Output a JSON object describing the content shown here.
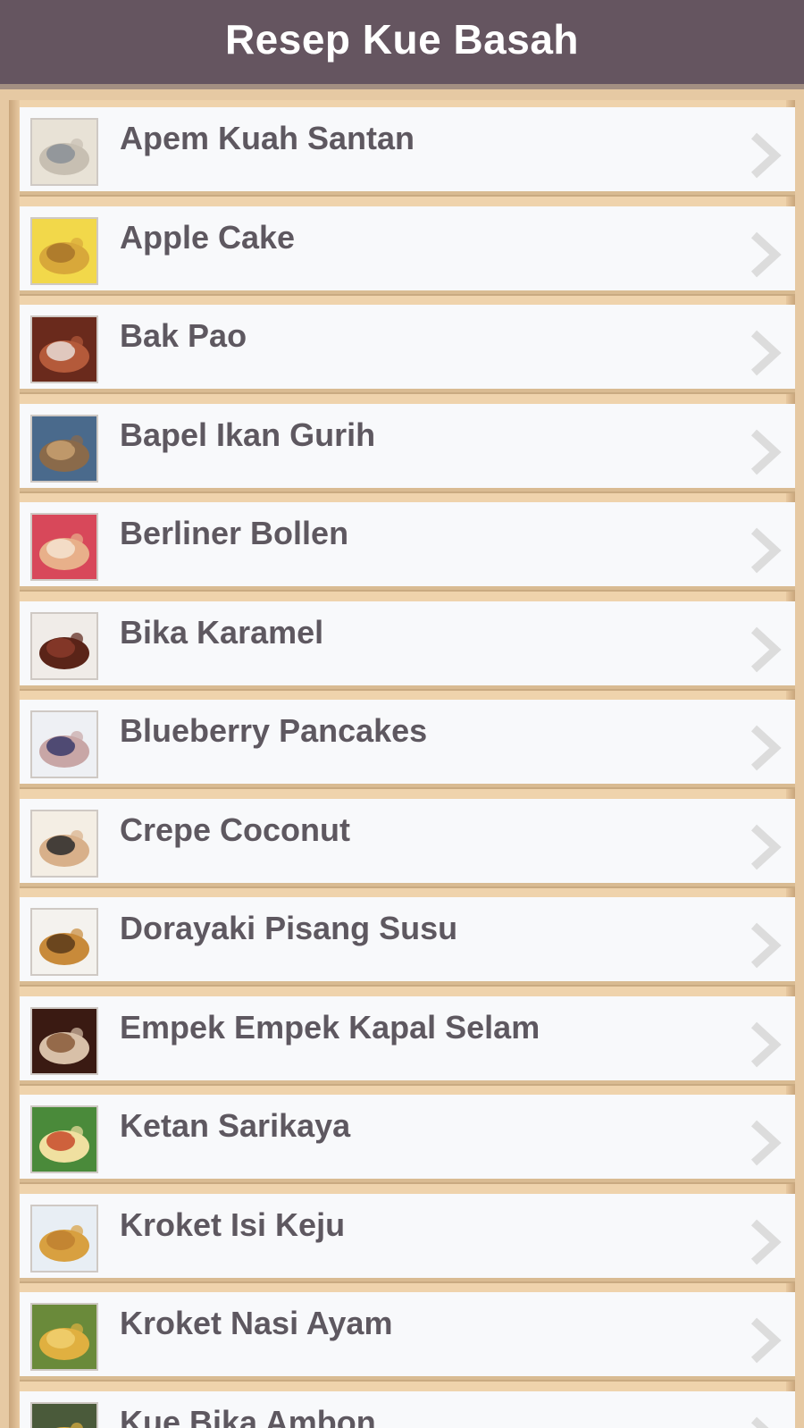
{
  "header": {
    "title": "Resep Kue Basah"
  },
  "recipes": [
    {
      "label": "Apem Kuah Santan",
      "icon": "apem-thumbnail",
      "colors": [
        "#e8e2d6",
        "#c7bfb2",
        "#8a8f96"
      ]
    },
    {
      "label": "Apple Cake",
      "icon": "apple-cake-thumbnail",
      "colors": [
        "#f2d84a",
        "#d8a83a",
        "#a8742a"
      ]
    },
    {
      "label": "Bak Pao",
      "icon": "bak-pao-thumbnail",
      "colors": [
        "#6a2a1c",
        "#b45a3a",
        "#e8dcd6"
      ]
    },
    {
      "label": "Bapel Ikan Gurih",
      "icon": "bapel-ikan-thumbnail",
      "colors": [
        "#4a6a8c",
        "#8a6a4a",
        "#c8a070"
      ]
    },
    {
      "label": "Berliner Bollen",
      "icon": "berliner-bollen-thumbnail",
      "colors": [
        "#d8485a",
        "#e8b08a",
        "#f4e4d0"
      ]
    },
    {
      "label": "Bika Karamel",
      "icon": "bika-karamel-thumbnail",
      "colors": [
        "#f0ece8",
        "#5a2418",
        "#8a3a2a"
      ]
    },
    {
      "label": "Blueberry Pancakes",
      "icon": "blueberry-pancakes-thumbnail",
      "colors": [
        "#eef0f4",
        "#c8a6a6",
        "#3a3a6a"
      ]
    },
    {
      "label": "Crepe Coconut",
      "icon": "crepe-coconut-thumbnail",
      "colors": [
        "#f4eee4",
        "#d8b08a",
        "#2a2a2a"
      ]
    },
    {
      "label": "Dorayaki Pisang Susu",
      "icon": "dorayaki-thumbnail",
      "colors": [
        "#f4f2ee",
        "#c88a3a",
        "#5a3a1a"
      ]
    },
    {
      "label": "Empek Empek Kapal Selam",
      "icon": "empek-empek-thumbnail",
      "colors": [
        "#3a1a12",
        "#d8c0a8",
        "#8a5a3a"
      ]
    },
    {
      "label": "Ketan Sarikaya",
      "icon": "ketan-sarikaya-thumbnail",
      "colors": [
        "#4a8a3a",
        "#f0e0a0",
        "#c84a2a"
      ]
    },
    {
      "label": "Kroket Isi Keju",
      "icon": "kroket-keju-thumbnail",
      "colors": [
        "#e8eef4",
        "#d8a040",
        "#c08030"
      ]
    },
    {
      "label": "Kroket Nasi Ayam",
      "icon": "kroket-nasi-ayam-thumbnail",
      "colors": [
        "#6a8a3a",
        "#e0b040",
        "#f0d070"
      ]
    },
    {
      "label": "Kue Bika Ambon",
      "icon": "kue-bika-ambon-thumbnail",
      "colors": [
        "#4a5a3a",
        "#e0b040",
        "#c88a2a"
      ]
    }
  ]
}
